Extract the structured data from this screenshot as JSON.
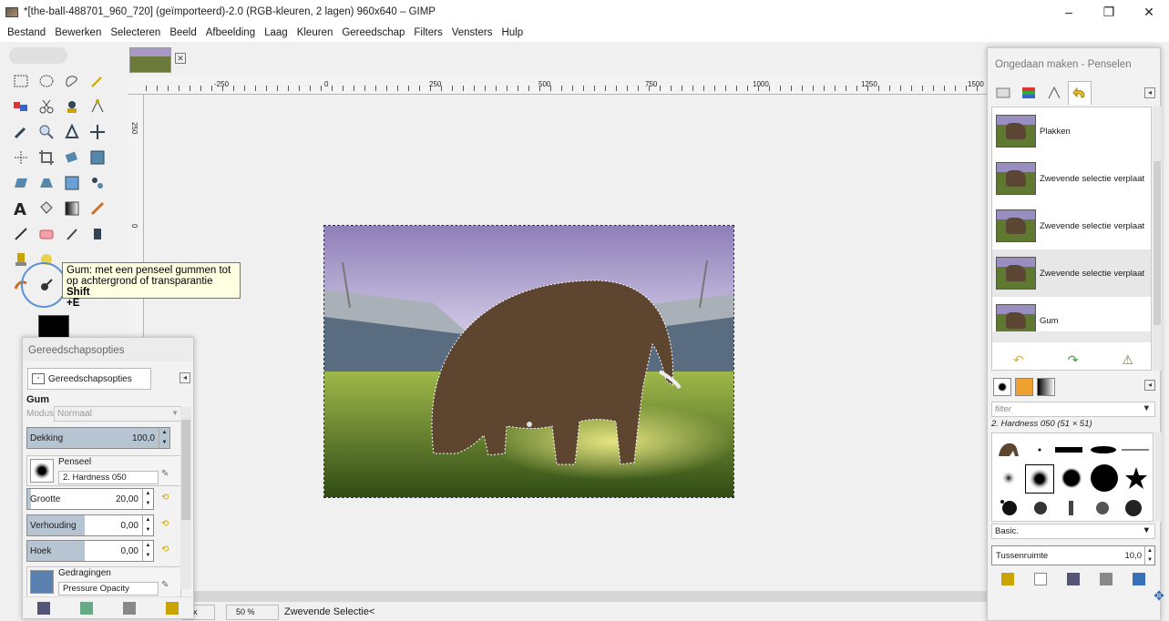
{
  "window": {
    "title": "*[the-ball-488701_960_720] (geïmporteerd)-2.0 (RGB-kleuren, 2 lagen) 960x640 – GIMP",
    "minimize_glyph": "–",
    "maximize_glyph": "❐",
    "close_glyph": "✕"
  },
  "menu": [
    "Bestand",
    "Bewerken",
    "Selecteren",
    "Beeld",
    "Afbeelding",
    "Laag",
    "Kleuren",
    "Gereedschap",
    "Filters",
    "Vensters",
    "Hulp"
  ],
  "image_tab": {
    "close_glyph": "✕"
  },
  "ruler": {
    "labels": [
      "-250",
      "0",
      "250",
      "500",
      "750",
      "1000",
      "1250",
      "1500"
    ]
  },
  "vruler": {
    "labels": [
      "250",
      "0"
    ]
  },
  "tooltip": {
    "line1": "Gum: met een penseel gummen tot",
    "line2": "op achtergrond of transparantie",
    "shortcut_a": "Shift",
    "shortcut_b": "+E"
  },
  "tool_options": {
    "header": "Gereedschapsopties",
    "tab_label": "Gereedschapsopties",
    "tool_name": "Gum",
    "mode_label": "Modus:",
    "mode_value": "Normaal",
    "opacity": {
      "label": "Dekking",
      "value": "100,0",
      "fraction": 1.0
    },
    "brush": {
      "label": "Penseel",
      "value": "2. Hardness 050"
    },
    "size": {
      "label": "Grootte",
      "value": "20,00",
      "fraction": 0.03
    },
    "ratio": {
      "label": "Verhouding",
      "value": "0,00",
      "fraction": 0.5
    },
    "angle": {
      "label": "Hoek",
      "value": "0,00",
      "fraction": 0.5
    },
    "dynamics": {
      "label": "Gedragingen",
      "value": "Pressure Opacity"
    }
  },
  "statusbar": {
    "unit": "px",
    "zoom": "50 %",
    "text": "Zwevende Selectie<"
  },
  "right_dock": {
    "header": "Ongedaan maken - Penselen",
    "undo_items": [
      {
        "label": "Plakken"
      },
      {
        "label": "Zwevende selectie verplaat"
      },
      {
        "label": "Zwevende selectie verplaat"
      },
      {
        "label": "Zwevende selectie verplaat"
      },
      {
        "label": "Gum"
      }
    ],
    "filter_placeholder": "filter",
    "brush_title": "2. Hardness 050 (51 × 51)",
    "brush_set": "Basic.",
    "spacing": {
      "label": "Tussenruimte",
      "value": "10,0"
    }
  },
  "colors": {
    "accent_ring": "#5b8fd1",
    "tooltip_bg": "#ffffe1",
    "slider_fill": "#b7c5d3"
  }
}
